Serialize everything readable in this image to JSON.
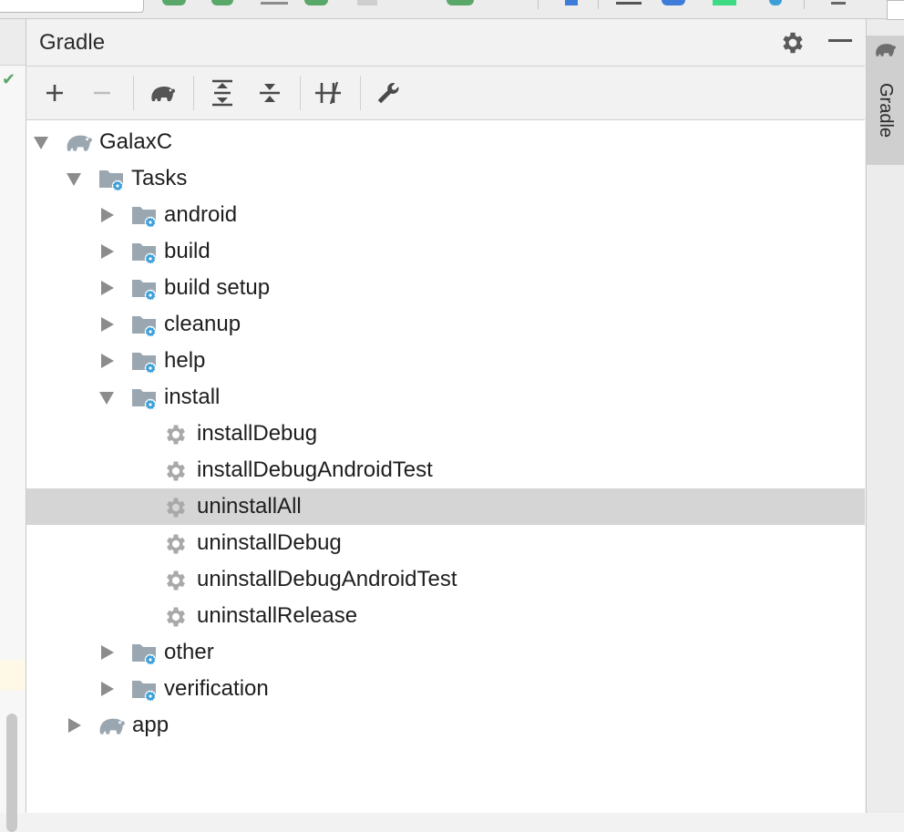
{
  "panel": {
    "title": "Gradle"
  },
  "toolbar": {
    "buttons": [
      {
        "name": "add-button",
        "icon": "plus-icon"
      },
      {
        "name": "remove-button",
        "icon": "minus-icon"
      },
      {
        "name": "execute-gradle-task-button",
        "icon": "elephant-icon"
      },
      {
        "name": "expand-all-button",
        "icon": "expand-all-icon"
      },
      {
        "name": "collapse-all-button",
        "icon": "collapse-all-icon"
      },
      {
        "name": "toggle-offline-mode-button",
        "icon": "offline-mode-icon"
      },
      {
        "name": "build-tool-settings-button",
        "icon": "wrench-icon"
      }
    ]
  },
  "tree": {
    "selected": "uninstallAll",
    "items": [
      {
        "label": "GalaxC",
        "type": "project",
        "state": "expanded",
        "depth": 0
      },
      {
        "label": "Tasks",
        "type": "folder",
        "state": "expanded",
        "depth": 1
      },
      {
        "label": "android",
        "type": "folder",
        "state": "collapsed",
        "depth": 2
      },
      {
        "label": "build",
        "type": "folder",
        "state": "collapsed",
        "depth": 2
      },
      {
        "label": "build setup",
        "type": "folder",
        "state": "collapsed",
        "depth": 2
      },
      {
        "label": "cleanup",
        "type": "folder",
        "state": "collapsed",
        "depth": 2
      },
      {
        "label": "help",
        "type": "folder",
        "state": "collapsed",
        "depth": 2
      },
      {
        "label": "install",
        "type": "folder",
        "state": "expanded",
        "depth": 2
      },
      {
        "label": "installDebug",
        "type": "task",
        "state": "leaf",
        "depth": 3
      },
      {
        "label": "installDebugAndroidTest",
        "type": "task",
        "state": "leaf",
        "depth": 3
      },
      {
        "label": "uninstallAll",
        "type": "task",
        "state": "leaf",
        "depth": 3
      },
      {
        "label": "uninstallDebug",
        "type": "task",
        "state": "leaf",
        "depth": 3
      },
      {
        "label": "uninstallDebugAndroidTest",
        "type": "task",
        "state": "leaf",
        "depth": 3
      },
      {
        "label": "uninstallRelease",
        "type": "task",
        "state": "leaf",
        "depth": 3
      },
      {
        "label": "other",
        "type": "folder",
        "state": "collapsed",
        "depth": 2
      },
      {
        "label": "verification",
        "type": "folder",
        "state": "collapsed",
        "depth": 2
      },
      {
        "label": "app",
        "type": "project",
        "state": "collapsed",
        "depth": 1
      }
    ]
  },
  "right_strip": {
    "tab_label": "Gradle"
  },
  "colors": {
    "selection": "#d5d5d5",
    "gear_blue": "#3d9fd8",
    "folder_gray": "#9aa7b0",
    "check_green": "#59a869"
  }
}
